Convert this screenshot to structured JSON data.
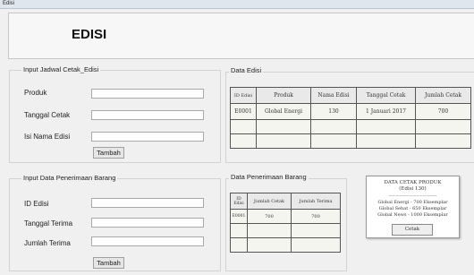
{
  "window": {
    "title": "Edisi"
  },
  "header": {
    "title": "EDISI"
  },
  "jadwal": {
    "group_title": "Input Jadwal Cetak_Edisi",
    "produk_label": "Produk",
    "tanggal_label": "Tanggal Cetak",
    "nama_label": "Isi Nama Edisi",
    "button": "Tambah"
  },
  "penerimaan": {
    "group_title": "Input Data Penerimaan Barang",
    "id_label": "ID Edisi",
    "tanggal_label": "Tanggal Terima",
    "jumlah_label": "Jumlah Terima",
    "button": "Tambah"
  },
  "data_edisi": {
    "title": "Data Edisi",
    "headers": [
      "ID Edisi",
      "Produk",
      "Nama Edisi",
      "Tanggal Cetak",
      "Jumlah Cetak"
    ],
    "rows": [
      [
        "E0001",
        "Global Energi",
        "130",
        "1 Januari 2017",
        "700"
      ]
    ]
  },
  "data_penerimaan": {
    "title": "Data Penerimaan Barang",
    "headers": [
      "ID Edisi",
      "Jumlah Cetak",
      "Jumlah Terima"
    ],
    "rows": [
      [
        "E0001",
        "700",
        "700"
      ]
    ]
  },
  "popup": {
    "title": "DATA CETAK PRODUK",
    "subtitle": "(Edisi 130)",
    "separator": "----------------------------------------",
    "lines": [
      "Global Energi - 700 Eksemplar",
      "Global Sehat - 650 Eksemplar",
      "Global News - 1000 Eksemplar"
    ],
    "button": "Cetak"
  }
}
